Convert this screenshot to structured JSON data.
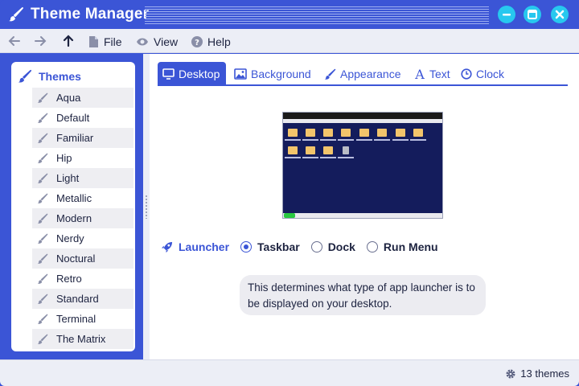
{
  "window": {
    "title": "Theme Manager"
  },
  "menubar": {
    "items": [
      {
        "label": "File",
        "icon": "file-icon"
      },
      {
        "label": "View",
        "icon": "eye-icon"
      },
      {
        "label": "Help",
        "icon": "help-icon"
      }
    ]
  },
  "sidebar": {
    "heading": "Themes",
    "items": [
      {
        "label": "Aqua"
      },
      {
        "label": "Default"
      },
      {
        "label": "Familiar"
      },
      {
        "label": "Hip"
      },
      {
        "label": "Light"
      },
      {
        "label": "Metallic"
      },
      {
        "label": "Modern"
      },
      {
        "label": "Nerdy"
      },
      {
        "label": "Noctural"
      },
      {
        "label": "Retro"
      },
      {
        "label": "Standard"
      },
      {
        "label": "Terminal"
      },
      {
        "label": "The Matrix"
      }
    ]
  },
  "tabs": [
    {
      "label": "Desktop",
      "icon": "monitor-icon",
      "active": true
    },
    {
      "label": "Background",
      "icon": "image-icon",
      "active": false
    },
    {
      "label": "Appearance",
      "icon": "brush-icon",
      "active": false
    },
    {
      "label": "Text",
      "icon": "text-icon",
      "active": false
    },
    {
      "label": "Clock",
      "icon": "clock-icon",
      "active": false
    }
  ],
  "launcher": {
    "label": "Launcher",
    "options": [
      {
        "label": "Taskbar",
        "selected": true
      },
      {
        "label": "Dock",
        "selected": false
      },
      {
        "label": "Run Menu",
        "selected": false
      }
    ],
    "hint": "This determines what type of app launcher is to be displayed on your desktop."
  },
  "status": {
    "text": "13 themes"
  },
  "colors": {
    "accent": "#3b55d6",
    "window_button": "#27c8ef",
    "panel": "#eceef6"
  }
}
